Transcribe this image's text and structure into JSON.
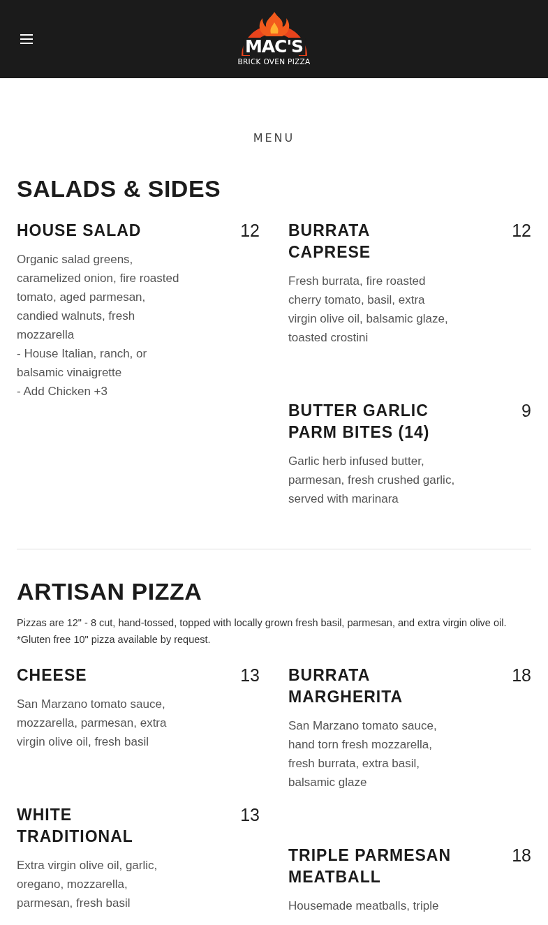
{
  "header": {
    "logo": {
      "name": "MAC'S",
      "tagline": "BRICK OVEN PIZZA"
    }
  },
  "page_title": "MENU",
  "sections": [
    {
      "title": "SALADS & SIDES",
      "columns": [
        [
          {
            "name": "HOUSE SALAD",
            "price": "12",
            "description": [
              "Organic salad greens, caramelized onion, fire roasted tomato, aged parmesan, candied walnuts, fresh mozzarella",
              "- House Italian, ranch, or balsamic vinaigrette",
              "- Add Chicken  +3"
            ]
          }
        ],
        [
          {
            "name": "BURRATA CAPRESE",
            "price": "12",
            "description": [
              "Fresh burrata, fire roasted cherry tomato, basil, extra virgin olive oil, balsamic glaze, toasted crostini"
            ]
          },
          {
            "name": "BUTTER GARLIC PARM BITES (14)",
            "price": "9",
            "description": [
              "Garlic herb infused butter, parmesan, fresh crushed garlic, served with marinara"
            ]
          }
        ]
      ]
    },
    {
      "title": "ARTISAN PIZZA",
      "note": [
        "Pizzas are 12\" - 8 cut, hand-tossed, topped with locally grown fresh basil, parmesan, and extra virgin olive oil.",
        "*Gluten free 10\" pizza available by request."
      ],
      "columns": [
        [
          {
            "name": "CHEESE",
            "price": "13",
            "description": [
              "San Marzano tomato sauce, mozzarella, parmesan, extra virgin olive oil, fresh basil"
            ]
          },
          {
            "name": "WHITE TRADITIONAL",
            "price": "13",
            "description": [
              "Extra virgin olive oil, garlic, oregano, mozzarella, parmesan, fresh basil"
            ]
          }
        ],
        [
          {
            "name": "BURRATA MARGHERITA",
            "price": "18",
            "description": [
              "San Marzano tomato sauce, hand torn fresh mozzarella, fresh burrata, extra basil, balsamic glaze"
            ]
          },
          {
            "name": "TRIPLE PARMESAN MEATBALL",
            "price": "18",
            "description": [
              "Housemade meatballs, triple"
            ]
          }
        ]
      ]
    }
  ]
}
